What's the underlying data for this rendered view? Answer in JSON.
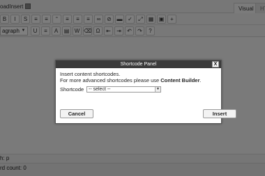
{
  "editor": {
    "upload_insert_label": "oadInsert",
    "tabs": {
      "visual": "Visual",
      "html": "HTML"
    },
    "toolbar_row1": [
      {
        "icon": "bold-icon",
        "glyph": "B"
      },
      {
        "icon": "italic-icon",
        "glyph": "I"
      },
      {
        "icon": "strikethrough-icon",
        "glyph": "S"
      },
      {
        "icon": "bullet-list-icon",
        "glyph": "≡"
      },
      {
        "icon": "numbered-list-icon",
        "glyph": "≡"
      },
      {
        "icon": "blockquote-icon",
        "glyph": "“"
      },
      {
        "icon": "align-left-icon",
        "glyph": "≡"
      },
      {
        "icon": "align-center-icon",
        "glyph": "≡"
      },
      {
        "icon": "align-right-icon",
        "glyph": "≡"
      },
      {
        "icon": "link-icon",
        "glyph": "∞"
      },
      {
        "icon": "unlink-icon",
        "glyph": "⊘"
      },
      {
        "icon": "more-icon",
        "glyph": "▬"
      },
      {
        "icon": "spellcheck-icon",
        "glyph": "✓"
      },
      {
        "icon": "fullscreen-icon",
        "glyph": "⤢"
      },
      {
        "icon": "kitchen-sink-icon",
        "glyph": "▦"
      },
      {
        "icon": "shortcode-icon",
        "glyph": "▣"
      },
      {
        "icon": "add-icon",
        "glyph": "+"
      }
    ],
    "toolbar_row2": [
      {
        "icon": "underline-icon",
        "glyph": "U"
      },
      {
        "icon": "justify-icon",
        "glyph": "≡"
      },
      {
        "icon": "text-color-icon",
        "glyph": "A"
      },
      {
        "icon": "paste-text-icon",
        "glyph": "▤"
      },
      {
        "icon": "paste-word-icon",
        "glyph": "W"
      },
      {
        "icon": "clear-format-icon",
        "glyph": "⌫"
      },
      {
        "icon": "special-char-icon",
        "glyph": "Ω"
      },
      {
        "icon": "outdent-icon",
        "glyph": "⇤"
      },
      {
        "icon": "indent-icon",
        "glyph": "⇥"
      },
      {
        "icon": "undo-icon",
        "glyph": "↶"
      },
      {
        "icon": "redo-icon",
        "glyph": "↷"
      },
      {
        "icon": "help-icon",
        "glyph": "?"
      }
    ],
    "format_select": "agraph",
    "path_text": "h: p",
    "word_count_text": "rd count: 0"
  },
  "dialog": {
    "title": "Shortcode Panel",
    "close_label": "X",
    "line1": "Insert content shortcodes.",
    "line2_prefix": "For more advanced shortcodes please use ",
    "line2_bold": "Content Builder",
    "line2_suffix": ".",
    "field_label": "Shortcode",
    "select_value": "-- select --",
    "cancel_label": "Cancel",
    "insert_label": "Insert"
  }
}
